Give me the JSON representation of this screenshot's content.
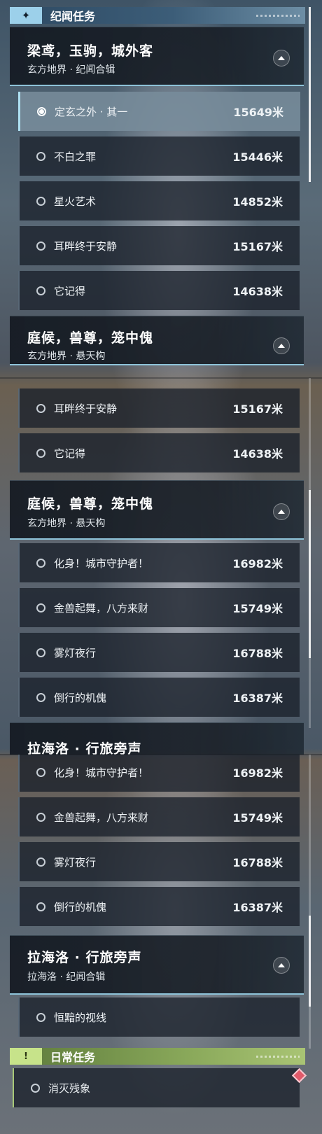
{
  "categories": {
    "story": {
      "icon": "sparkle-icon",
      "title": "纪闻任务",
      "accent": "#9cd0ea"
    },
    "daily": {
      "icon": "exclamation-icon",
      "title": "日常任务",
      "accent": "#c7e38a"
    }
  },
  "chapters": {
    "liangyuan": {
      "title": "梁鸢，玉驹，城外客",
      "subtitle": "玄方地界 · 纪闻合辑"
    },
    "tinghou": {
      "title": "庭候，兽尊，笼中傀",
      "subtitle": "玄方地界 · 悬天构"
    },
    "lahailuo": {
      "title": "拉海洛 · 行旅旁声",
      "subtitle": "拉海洛 · 纪闻合辑",
      "partial_title": "拉海洛 · 行旅旁声"
    }
  },
  "quests": {
    "q1": {
      "name": "定玄之外 · 其一",
      "distance": "15649米",
      "selected": true
    },
    "q2": {
      "name": "不白之罪",
      "distance": "15446米"
    },
    "q3": {
      "name": "星火艺术",
      "distance": "14852米"
    },
    "q4": {
      "name": "耳畔终于安静",
      "distance": "15167米"
    },
    "q5": {
      "name": "它记得",
      "distance": "14638米"
    },
    "q6": {
      "name": "化身！城市守护者！",
      "distance": "16982米"
    },
    "q7": {
      "name": "金兽起舞，八方来财",
      "distance": "15749米"
    },
    "q8": {
      "name": "雾灯夜行",
      "distance": "16788米"
    },
    "q9": {
      "name": "倒行的机傀",
      "distance": "16387米"
    },
    "q10": {
      "name": "恒黯的视线",
      "distance": ""
    },
    "q11": {
      "name": "消灭残象",
      "distance": ""
    }
  },
  "colors": {
    "chapter_underline": "#8ec3d9",
    "tracked_marker": "#e05a6a"
  }
}
